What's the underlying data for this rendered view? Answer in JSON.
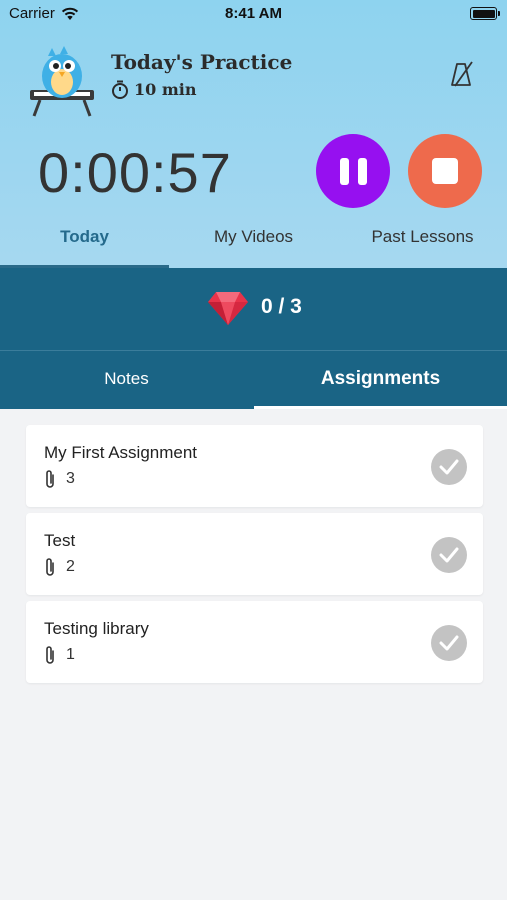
{
  "status_bar": {
    "carrier": "Carrier",
    "time": "8:41 AM"
  },
  "header": {
    "title": "Today's Practice",
    "duration": "10 min",
    "icons": {
      "mascot": "bird-keyboard-mascot",
      "timer": "stopwatch-icon",
      "metronome": "metronome-off-icon"
    }
  },
  "timer": {
    "elapsed": "0:00:57"
  },
  "controls": {
    "pause_color": "#9610f0",
    "stop_color": "#ee6a4c"
  },
  "tabs": [
    {
      "label": "Today",
      "active": true
    },
    {
      "label": "My Videos",
      "active": false
    },
    {
      "label": "Past Lessons",
      "active": false
    }
  ],
  "gems": {
    "count": "0 / 3",
    "icon": "ruby-gem-icon"
  },
  "sub_tabs": [
    {
      "label": "Notes",
      "active": false
    },
    {
      "label": "Assignments",
      "active": true
    }
  ],
  "assignments": [
    {
      "title": "My First Assignment",
      "attachments": "3"
    },
    {
      "title": "Test",
      "attachments": "2"
    },
    {
      "title": "Testing library",
      "attachments": "1"
    }
  ],
  "colors": {
    "accent_bar": "#1a6485",
    "header_bg": "#8ed3ef"
  }
}
